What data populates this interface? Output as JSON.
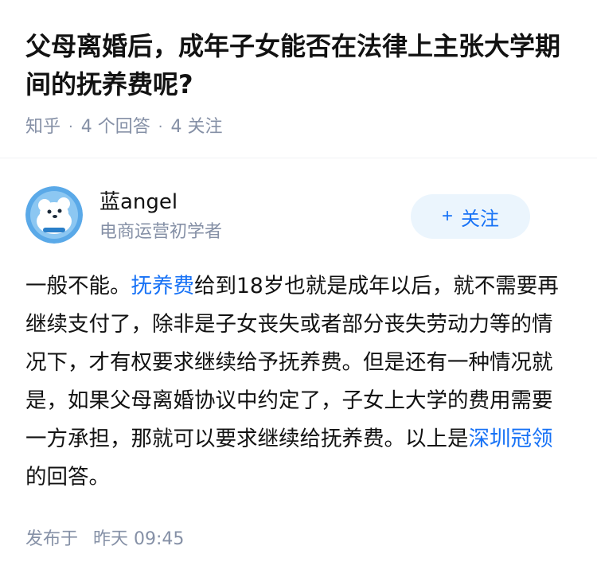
{
  "question": {
    "title": "父母离婚后，成年子女能否在法律上主张大学期间的抚养费呢?",
    "source": "知乎",
    "separator": "·",
    "answers_count": "4 个回答",
    "followers_count": "4 关注"
  },
  "author": {
    "name": "蓝angel",
    "bio": "电商运营初学者",
    "avatar_icon": "bear-avatar-icon",
    "follow_label": "关注",
    "follow_icon": "+"
  },
  "answer": {
    "text_1": "一般不能。",
    "link_1": "抚养费",
    "text_2": "给到18岁也就是成年以后，就不需要再继续支付了，除非是子女丧失或者部分丧失劳动力等的情况下，才有权要求继续给予抚养费。但是还有一种情况就是，如果父母离婚协议中约定了，子女上大学的费用需要一方承担，那就可以要求继续给抚养费。以上是",
    "link_2": "深圳冠领",
    "text_3": "的回答。"
  },
  "footer": {
    "published_label": "发布于",
    "published_time": "昨天 09:45"
  },
  "colors": {
    "link": "#1772f6",
    "meta": "#8590a6",
    "follow_bg": "#ebf5fd"
  }
}
